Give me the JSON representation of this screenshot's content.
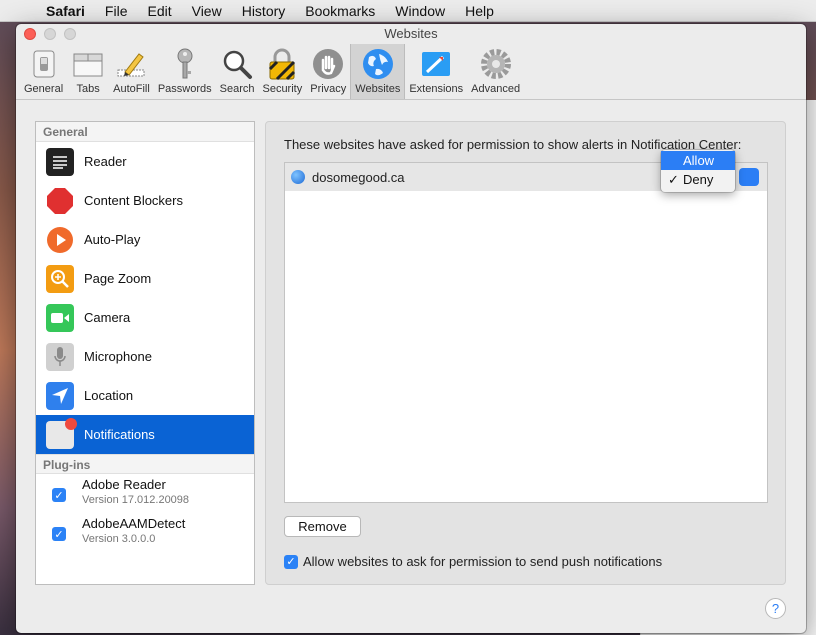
{
  "menubar": {
    "items": [
      "Safari",
      "File",
      "Edit",
      "View",
      "History",
      "Bookmarks",
      "Window",
      "Help"
    ]
  },
  "window": {
    "title": "Websites"
  },
  "toolbar": {
    "items": [
      {
        "label": "General",
        "icon": "general-switch-icon"
      },
      {
        "label": "Tabs",
        "icon": "tabs-icon"
      },
      {
        "label": "AutoFill",
        "icon": "pencil-icon"
      },
      {
        "label": "Passwords",
        "icon": "key-icon"
      },
      {
        "label": "Search",
        "icon": "magnifier-icon"
      },
      {
        "label": "Security",
        "icon": "lock-icon"
      },
      {
        "label": "Privacy",
        "icon": "hand-icon"
      },
      {
        "label": "Websites",
        "icon": "globe-icon",
        "active": true
      },
      {
        "label": "Extensions",
        "icon": "puzzle-icon"
      },
      {
        "label": "Advanced",
        "icon": "gear-icon"
      }
    ]
  },
  "sidebar": {
    "general_header": "General",
    "items": [
      {
        "label": "Reader",
        "icon": "reader-icon",
        "color": "#222222"
      },
      {
        "label": "Content Blockers",
        "icon": "stop-icon",
        "color": "#e03030"
      },
      {
        "label": "Auto-Play",
        "icon": "play-icon",
        "color": "#f06a2b"
      },
      {
        "label": "Page Zoom",
        "icon": "zoom-icon",
        "color": "#f39c12"
      },
      {
        "label": "Camera",
        "icon": "camera-icon",
        "color": "#35c759"
      },
      {
        "label": "Microphone",
        "icon": "microphone-icon",
        "color": "#c8c8c8"
      },
      {
        "label": "Location",
        "icon": "location-icon",
        "color": "#2f80ed"
      },
      {
        "label": "Notifications",
        "icon": "notifications-icon",
        "color": "#e8e8e8",
        "selected": true
      }
    ],
    "plugins_header": "Plug-ins",
    "plugins": [
      {
        "name": "Adobe Reader",
        "version": "Version 17.012.20098",
        "checked": true
      },
      {
        "name": "AdobeAAMDetect",
        "version": "Version 3.0.0.0",
        "checked": true
      }
    ]
  },
  "panel": {
    "description": "These websites have asked for permission to show alerts in Notification Center:",
    "sites": [
      {
        "domain": "dosomegood.ca",
        "permission": "Deny"
      }
    ],
    "remove_label": "Remove",
    "allow_push_label": "Allow websites to ask for permission to send push notifications",
    "allow_push_checked": true
  },
  "dropdown": {
    "options": [
      {
        "label": "Allow",
        "highlighted": true,
        "checked": false
      },
      {
        "label": "Deny",
        "highlighted": false,
        "checked": true
      }
    ]
  },
  "help_label": "?",
  "colors": {
    "accent": "#2b7ef5",
    "selection": "#0a63d4",
    "close": "#fc5f57"
  }
}
